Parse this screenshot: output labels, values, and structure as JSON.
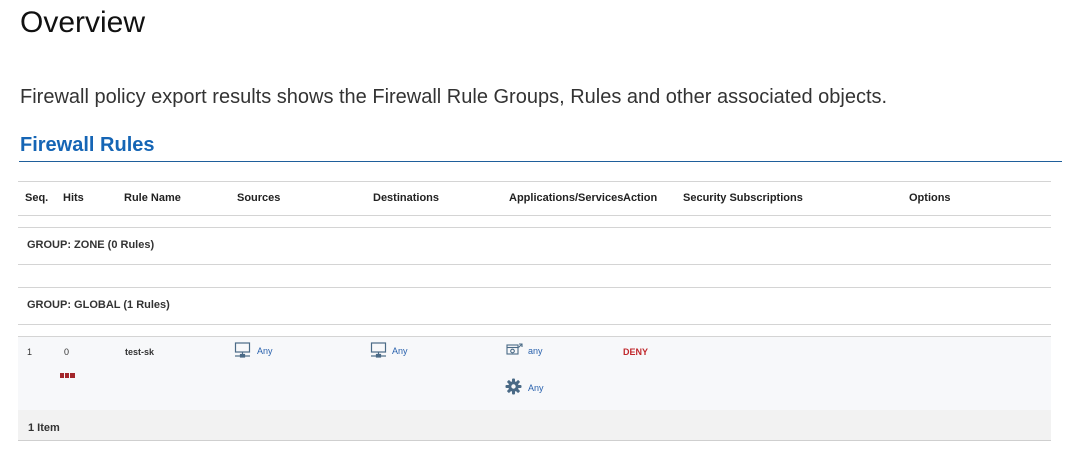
{
  "page": {
    "title": "Overview",
    "description": "Firewall policy export results shows the Firewall Rule Groups, Rules and other associated objects."
  },
  "section": {
    "title": "Firewall Rules"
  },
  "table": {
    "columns": [
      "Seq.",
      "Hits",
      "Rule Name",
      "Sources",
      "Destinations",
      "Applications/Services",
      "Action",
      "Security Subscriptions",
      "Options"
    ],
    "groups": [
      {
        "label": "GROUP: ZONE (0 Rules)"
      },
      {
        "label": "GROUP: GLOBAL (1 Rules)"
      }
    ],
    "rows": [
      {
        "seq": "1",
        "hits": "0",
        "rule_name": "test-sk",
        "source": "Any",
        "destination": "Any",
        "application": "any",
        "service": "Any",
        "action": "DENY",
        "hits_bar_color": "#a3262b"
      }
    ],
    "footer": "1 Item"
  },
  "colors": {
    "accent": "#1565b5",
    "deny": "#c0282c",
    "link": "#2a62ad",
    "icon": "#4a6a86"
  },
  "icons": {
    "source": "network-computer-icon",
    "destination": "network-computer-icon",
    "application": "application-icon",
    "service": "gear-icon"
  }
}
